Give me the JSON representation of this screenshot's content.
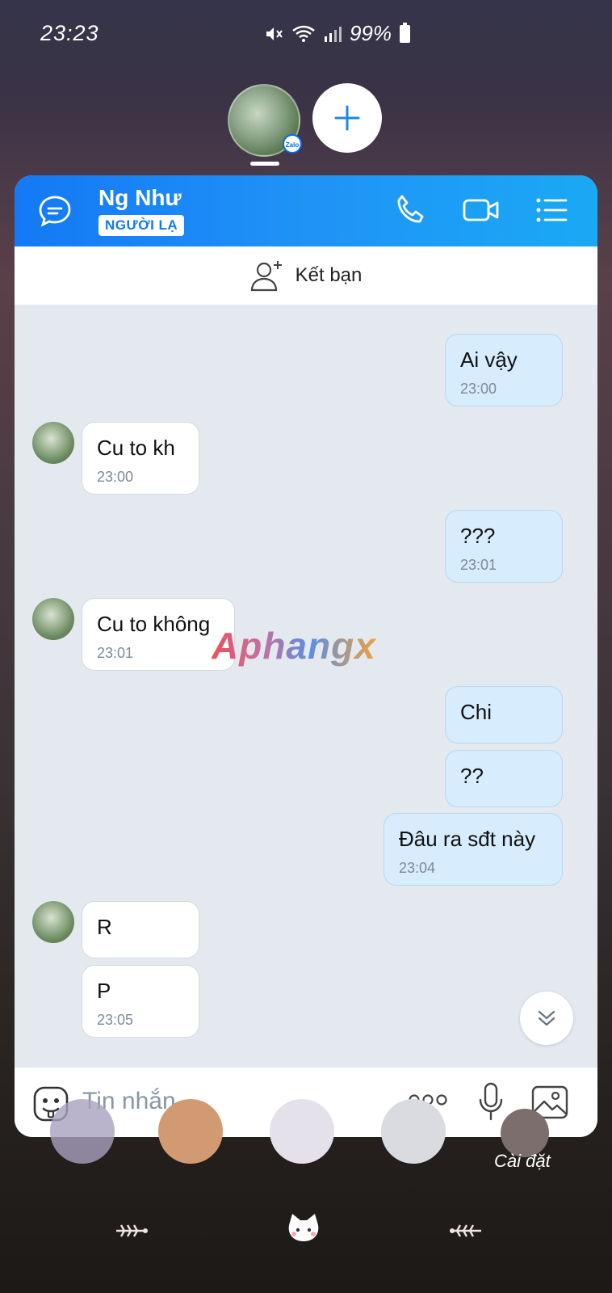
{
  "status_bar": {
    "time": "23:23",
    "battery": "99%"
  },
  "chat": {
    "contact_name": "Ng Như",
    "contact_tag": "NGƯỜI LẠ",
    "add_friend_label": "Kết bạn",
    "input_placeholder": "Tin nhắn",
    "messages": [
      {
        "dir": "out",
        "text": "Ai vậy",
        "time": "23:00"
      },
      {
        "dir": "in",
        "text": "Cu to kh",
        "time": "23:00"
      },
      {
        "dir": "out",
        "text": "???",
        "time": "23:01"
      },
      {
        "dir": "in",
        "text": "Cu to không",
        "time": "23:01"
      },
      {
        "dir": "out",
        "text": "Chi",
        "time": ""
      },
      {
        "dir": "out",
        "text": "??",
        "time": ""
      },
      {
        "dir": "out",
        "text": "Đâu ra sđt này",
        "time": "23:04"
      },
      {
        "dir": "in",
        "text": "R",
        "time": ""
      },
      {
        "dir": "in",
        "text": "P",
        "time": "23:05"
      }
    ]
  },
  "watermark": "Aphangx",
  "zalo_badge": "Zalo",
  "dock": {
    "settings_label": "Cài đặt"
  },
  "colors": {
    "header_start": "#1479f5",
    "header_end": "#1aa9f5",
    "bubble_out": "#d7ecfd",
    "bubble_in": "#ffffff",
    "chat_bg": "#e4e9f0"
  }
}
